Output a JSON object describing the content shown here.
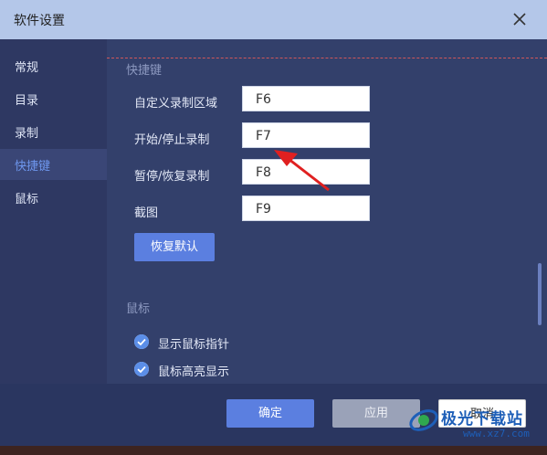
{
  "window": {
    "title": "软件设置"
  },
  "sidebar": {
    "items": [
      {
        "label": "常规",
        "active": false
      },
      {
        "label": "目录",
        "active": false
      },
      {
        "label": "录制",
        "active": false
      },
      {
        "label": "快捷键",
        "active": true
      },
      {
        "label": "鼠标",
        "active": false
      }
    ]
  },
  "shortcuts": {
    "section_title": "快捷键",
    "rows": [
      {
        "label": "自定义录制区域",
        "value": "F6"
      },
      {
        "label": "开始/停止录制",
        "value": "F7"
      },
      {
        "label": "暂停/恢复录制",
        "value": "F8"
      },
      {
        "label": "截图",
        "value": "F9"
      }
    ],
    "restore_label": "恢复默认"
  },
  "mouse": {
    "section_title": "鼠标",
    "options": [
      {
        "label": "显示鼠标指针",
        "checked": true
      },
      {
        "label": "鼠标高亮显示",
        "checked": true
      }
    ]
  },
  "footer": {
    "ok_label": "确定",
    "apply_label": "应用",
    "cancel_label": "取消"
  },
  "watermark": {
    "text": "极光下载站",
    "url": "www.xz7.com"
  },
  "colors": {
    "accent": "#5b7fe0",
    "active_nav": "#6e97ee",
    "annotation": "#e02020"
  }
}
